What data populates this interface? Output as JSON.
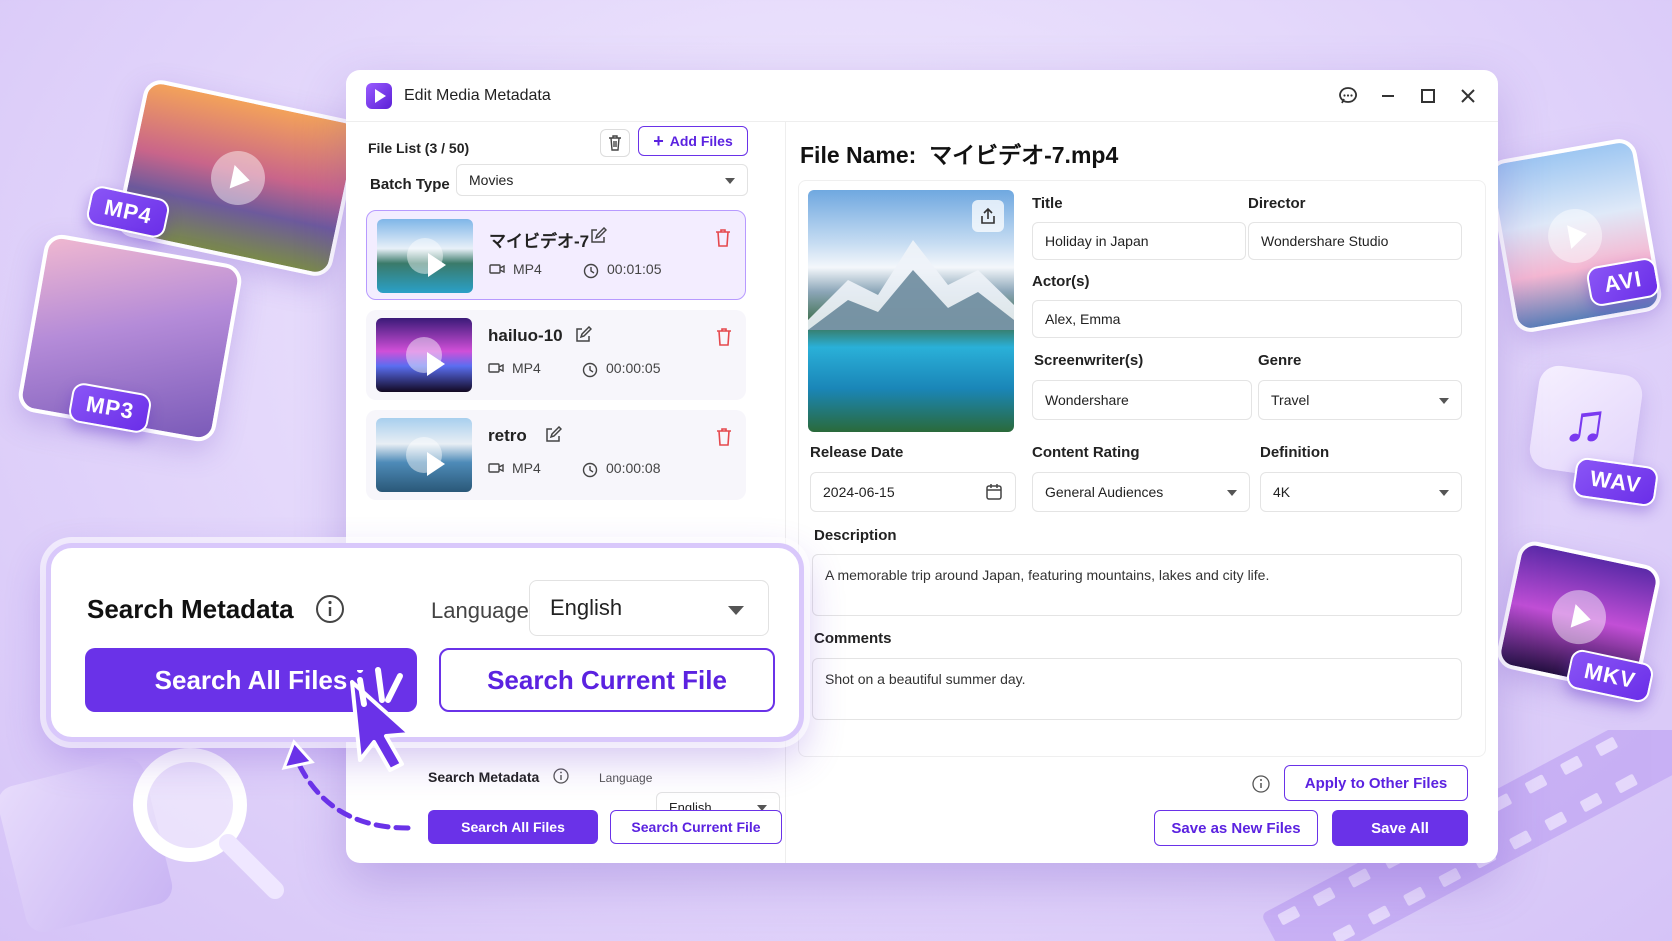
{
  "window": {
    "title": "Edit Media Metadata"
  },
  "deco": {
    "mp4": "MP4",
    "mp3": "MP3",
    "avi": "AVI",
    "wav": "WAV",
    "mkv": "MKV"
  },
  "file_list": {
    "header": "File List (3 / 50)",
    "add_files": "Add Files",
    "batch_type_label": "Batch Type",
    "batch_type_value": "Movies",
    "items": [
      {
        "name": "マイビデオ-7",
        "format": "MP4",
        "duration": "00:01:05",
        "selected": true
      },
      {
        "name": "hailuo-10",
        "format": "MP4",
        "duration": "00:00:05",
        "selected": false
      },
      {
        "name": "retro",
        "format": "MP4",
        "duration": "00:00:08",
        "selected": false
      }
    ]
  },
  "search_small": {
    "label": "Search Metadata",
    "language_label": "Language",
    "language_value": "English",
    "search_all": "Search All Files",
    "search_current": "Search Current File"
  },
  "search_popup": {
    "label": "Search Metadata",
    "language_label": "Language",
    "language_value": "English",
    "search_all": "Search All Files",
    "search_current": "Search Current File"
  },
  "details": {
    "file_name_label": "File Name:",
    "file_name": "マイビデオ-7.mp4",
    "title_label": "Title",
    "title_value": "Holiday in Japan",
    "director_label": "Director",
    "director_value": "Wondershare Studio",
    "actors_label": "Actor(s)",
    "actors_value": "Alex, Emma",
    "screenwriter_label": "Screenwriter(s)",
    "screenwriter_value": "Wondershare",
    "genre_label": "Genre",
    "genre_value": "Travel",
    "release_label": "Release Date",
    "release_value": "2024-06-15",
    "rating_label": "Content Rating",
    "rating_value": "General Audiences",
    "definition_label": "Definition",
    "definition_value": "4K",
    "description_label": "Description",
    "description_value": "A memorable trip around Japan, featuring mountains, lakes and city life.",
    "comments_label": "Comments",
    "comments_value": "Shot on a beautiful summer day."
  },
  "footer": {
    "apply_other": "Apply to Other Files",
    "save_new": "Save as New Files",
    "save_all": "Save All"
  },
  "colors": {
    "accent": "#6a32e8",
    "delete": "#e5484d",
    "background": "#e4d8fb"
  }
}
